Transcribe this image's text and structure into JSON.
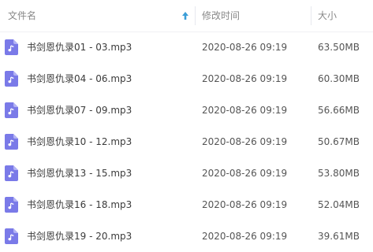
{
  "header": {
    "name_label": "文件名",
    "date_label": "修改时间",
    "size_label": "大小",
    "sort_icon": "arrow-up-icon",
    "sort_color": "#3b9ed8"
  },
  "file_icon": {
    "name": "music-file-icon",
    "color": "#7a7ae8"
  },
  "files": [
    {
      "name": "书剑恩仇录01 - 03.mp3",
      "date": "2020-08-26 09:19",
      "size": "63.50MB"
    },
    {
      "name": "书剑恩仇录04 - 06.mp3",
      "date": "2020-08-26 09:19",
      "size": "60.30MB"
    },
    {
      "name": "书剑恩仇录07 - 09.mp3",
      "date": "2020-08-26 09:19",
      "size": "56.66MB"
    },
    {
      "name": "书剑恩仇录10 - 12.mp3",
      "date": "2020-08-26 09:19",
      "size": "50.67MB"
    },
    {
      "name": "书剑恩仇录13 - 15.mp3",
      "date": "2020-08-26 09:19",
      "size": "53.80MB"
    },
    {
      "name": "书剑恩仇录16 - 18.mp3",
      "date": "2020-08-26 09:19",
      "size": "52.04MB"
    },
    {
      "name": "书剑恩仇录19 - 20.mp3",
      "date": "2020-08-26 09:19",
      "size": "39.61MB"
    }
  ]
}
